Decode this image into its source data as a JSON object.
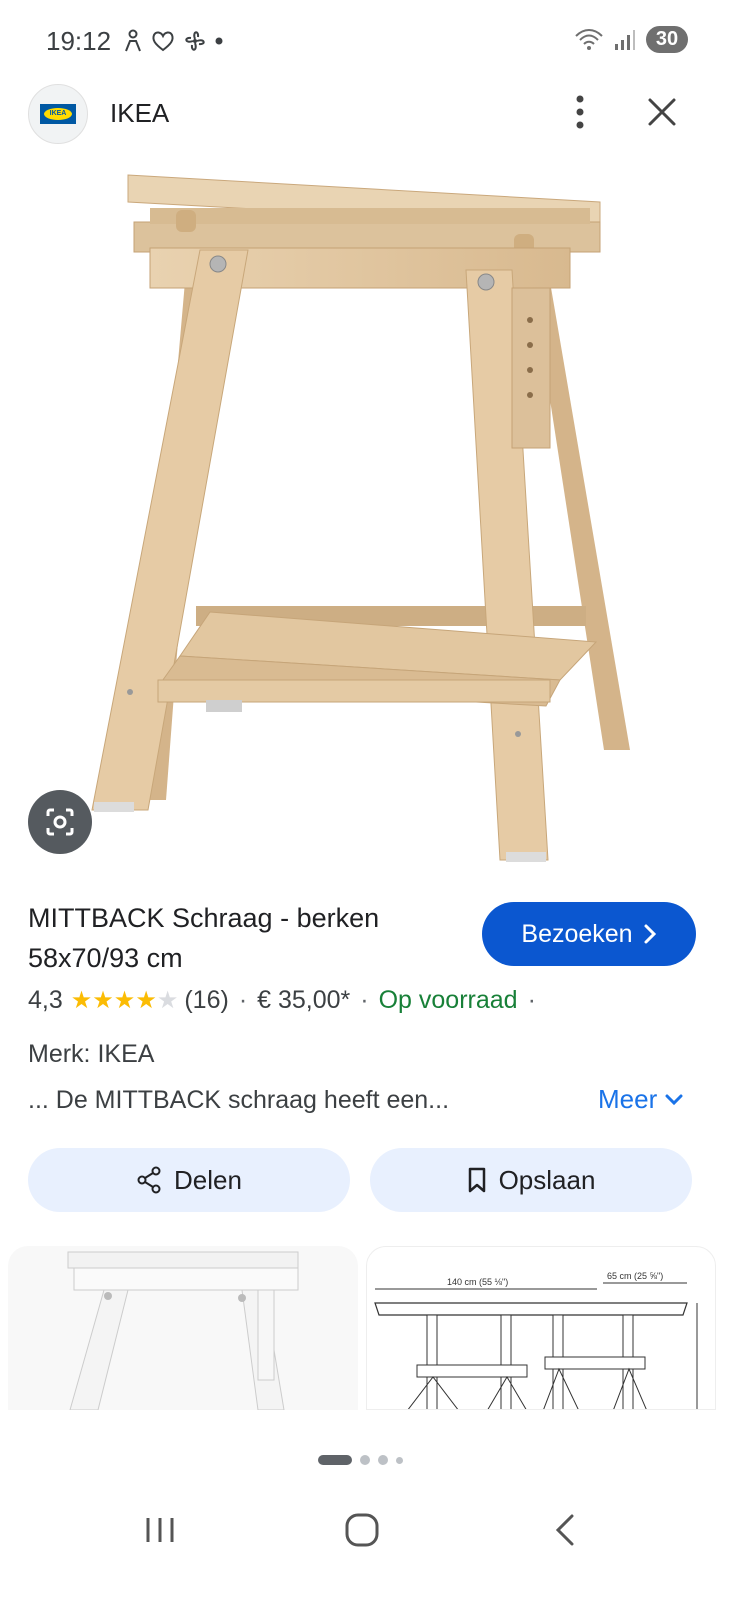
{
  "status_bar": {
    "time": "19:12",
    "battery": "30"
  },
  "header": {
    "title": "IKEA",
    "logo_text": "IKEA"
  },
  "product": {
    "title": "MITTBACK Schraag - berken 58x70/93 cm",
    "rating": "4,3",
    "rating_value": 4.3,
    "rating_max": 5,
    "reviews": "(16)",
    "price": "€ 35,00*",
    "stock": "Op voorraad",
    "brand": "Merk: IKEA",
    "description": "... De MITTBACK schraag heeft een...",
    "more_label": "Meer"
  },
  "buttons": {
    "visit": "Bezoeken",
    "share": "Delen",
    "save": "Opslaan"
  },
  "thumbnails": {
    "diagram_label_1": "140 cm (55 ⅛\")",
    "diagram_label_2": "65 cm (25 ⅝\")"
  },
  "colors": {
    "accent": "#0b57d0",
    "link": "#1a73e8",
    "stock_green": "#188038",
    "star": "#fbbc04",
    "chip_bg": "#e8f0fe",
    "wood": "#e3c9a4"
  }
}
